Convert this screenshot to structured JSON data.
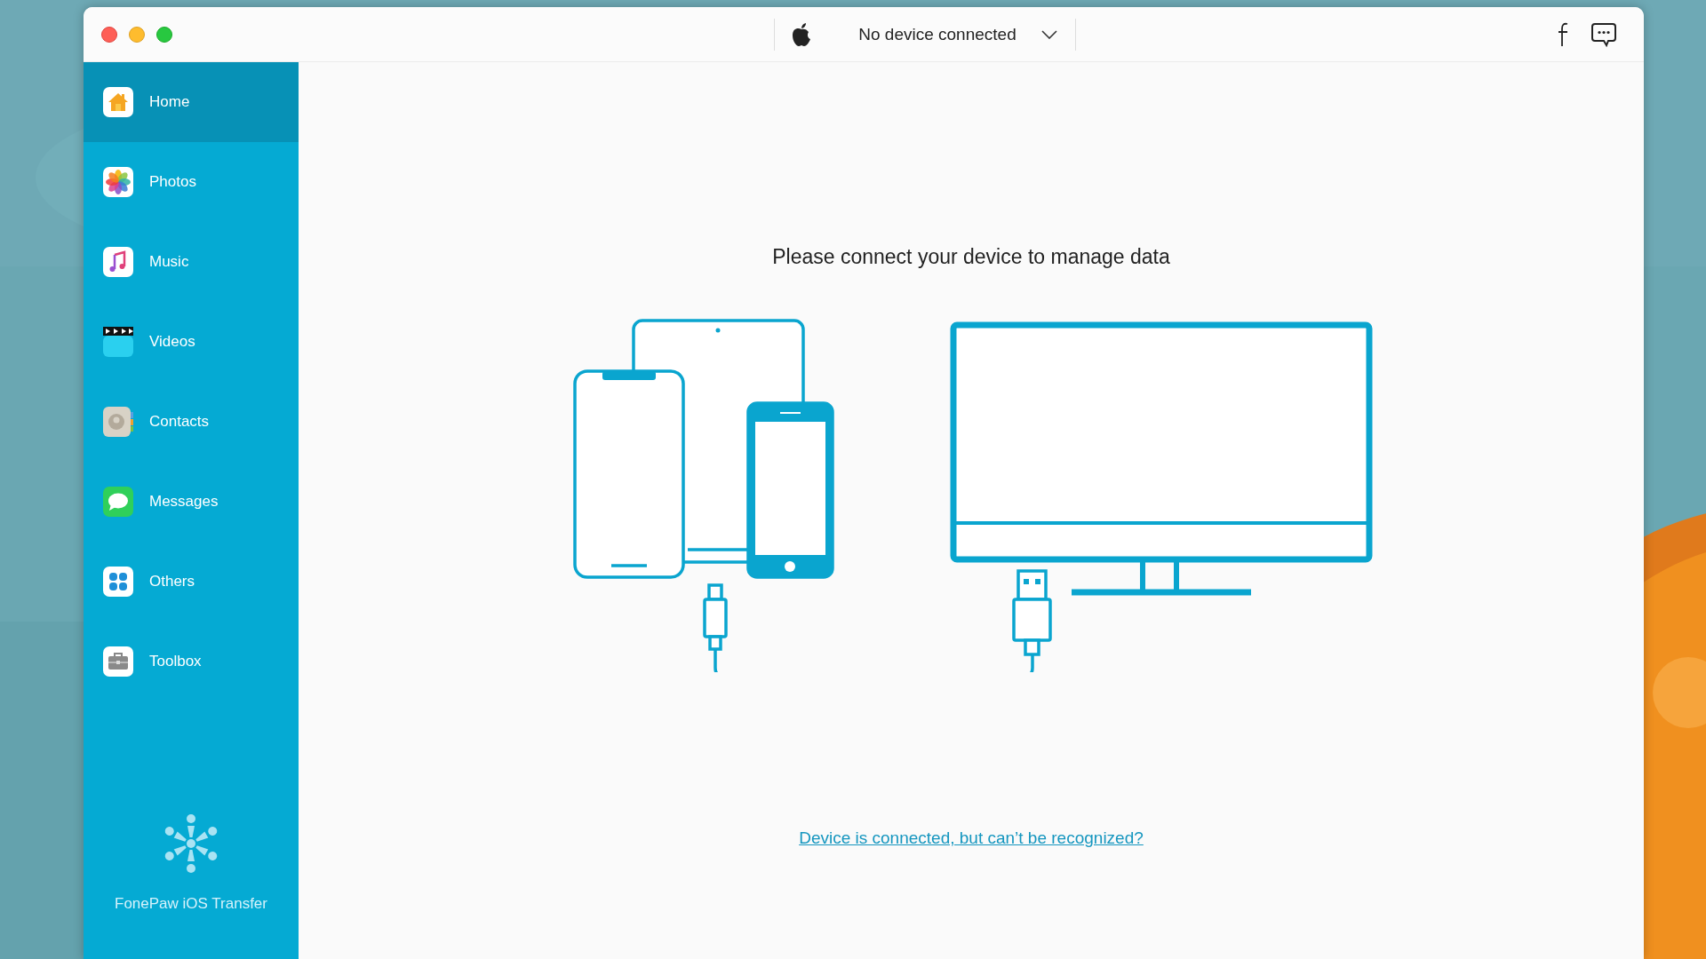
{
  "device_selector": {
    "text": "No device connected"
  },
  "sidebar": {
    "items": [
      {
        "label": "Home",
        "kind": "home",
        "selected": true
      },
      {
        "label": "Photos",
        "kind": "photos",
        "selected": false
      },
      {
        "label": "Music",
        "kind": "music",
        "selected": false
      },
      {
        "label": "Videos",
        "kind": "videos",
        "selected": false
      },
      {
        "label": "Contacts",
        "kind": "contacts",
        "selected": false
      },
      {
        "label": "Messages",
        "kind": "messages",
        "selected": false
      },
      {
        "label": "Others",
        "kind": "others",
        "selected": false
      },
      {
        "label": "Toolbox",
        "kind": "toolbox",
        "selected": false
      }
    ],
    "app_name": "FonePaw iOS Transfer"
  },
  "main": {
    "heading": "Please connect your device to manage data",
    "help_link": "Device is connected, but can’t be recognized?"
  }
}
